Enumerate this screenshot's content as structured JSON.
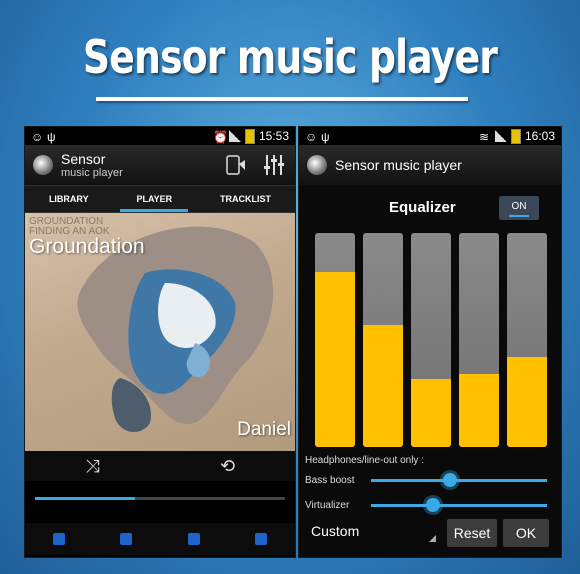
{
  "promo": {
    "title": "Sensor music player"
  },
  "left_phone": {
    "status": {
      "time": "15:53"
    },
    "app": {
      "title_line1": "Sensor",
      "title_line2": "music player"
    },
    "tabs": [
      "LIBRARY",
      "PLAYER",
      "TRACKLIST"
    ],
    "active_tab": "PLAYER",
    "album": {
      "cover_text_line1": "GROUNDATION",
      "cover_text_line2": "FINDING AN AOK",
      "artist": "Groundation",
      "track": "Daniel"
    },
    "progress": 0.4,
    "icons": {
      "shuffle": "shuffle-icon",
      "repeat": "repeat-icon",
      "prev": "previous-icon",
      "pause": "pause-icon",
      "next": "next-icon",
      "stop": "stop-icon"
    }
  },
  "right_phone": {
    "status": {
      "time": "16:03"
    },
    "app": {
      "title": "Sensor music player"
    },
    "equalizer": {
      "title": "Equalizer",
      "toggle_label": "ON",
      "bands": [
        0.82,
        0.57,
        0.32,
        0.34,
        0.42
      ],
      "headphones_label": "Headphones/line-out only :",
      "bass_boost_label": "Bass boost",
      "bass_boost_level": 0.45,
      "virtualizer_label": "Virtualizer",
      "virtualizer_level": 0.35,
      "preset": "Custom",
      "reset_label": "Reset",
      "ok_label": "OK"
    }
  },
  "colors": {
    "accent": "#3aa9e6",
    "eq_fill": "#ffc000"
  }
}
